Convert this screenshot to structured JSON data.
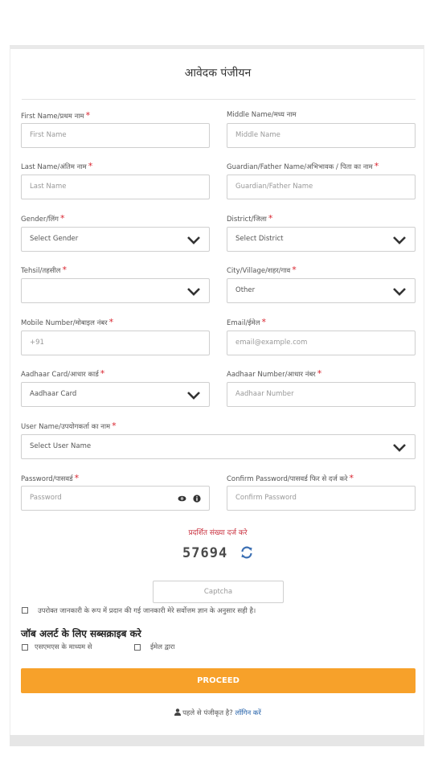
{
  "title": "आवेदक पंजीयन",
  "required_mark": "*",
  "fields": {
    "first_name": {
      "label": "First Name/प्रथम नाम",
      "placeholder": "First Name"
    },
    "middle_name": {
      "label": "Middle Name/मध्य नाम",
      "placeholder": "Middle Name"
    },
    "last_name": {
      "label": "Last Name/अंतिम नाम",
      "placeholder": "Last Name"
    },
    "guardian_name": {
      "label": "Guardian/Father Name/अभिभावक / पिता का नाम",
      "placeholder": "Guardian/Father Name"
    },
    "gender": {
      "label": "Gender/लिंग",
      "value": "Select Gender"
    },
    "district": {
      "label": "District/जिला",
      "value": "Select District"
    },
    "tehsil": {
      "label": "Tehsil/तहसील",
      "value": ""
    },
    "city": {
      "label": "City/Village/शहर/गाव",
      "value": "Other"
    },
    "mobile": {
      "label": "Mobile Number/मोबाइल नंबर",
      "placeholder": "+91"
    },
    "email": {
      "label": "Email/ईमेल",
      "placeholder": "email@example.com"
    },
    "aadhaar_card": {
      "label": "Aadhaar Card/आधार कार्ड",
      "value": "Aadhaar Card"
    },
    "aadhaar_number": {
      "label": "Aadhaar Number/आधार नंबर",
      "placeholder": "Aadhaar Number"
    },
    "user_name": {
      "label": "User Name/उपयोगकर्ता का नाम",
      "value": "Select User Name"
    },
    "password": {
      "label": "Password/पासवर्ड",
      "placeholder": "Password"
    },
    "confirm_password": {
      "label": "Confirm Password/पासवर्ड फिर से दर्ज करे",
      "placeholder": "Confirm Password"
    }
  },
  "captcha": {
    "label": "प्रदर्शित संख्या दर्ज करे",
    "code": "57694",
    "placeholder": "Captcha"
  },
  "declaration": "उपरोक्त जानकारी के रूप में प्रदान की गई जानकारी मेरे सर्वोत्तम ज्ञान के अनुसार सही है।",
  "job_alert": {
    "heading": "जॉब अलर्ट के लिए सब्सक्राइब करे",
    "sms": "एसएमएस के माध्यम से",
    "email": "ईमेल द्वारा"
  },
  "proceed_label": "PROCEED",
  "login": {
    "text": "पहले से पंजीकृत है?",
    "link": "लॉगिन करें"
  },
  "colors": {
    "accent": "#f7a12a",
    "required": "#d9232e",
    "captcha_label": "#c9303e",
    "link": "#1f5ea8"
  }
}
